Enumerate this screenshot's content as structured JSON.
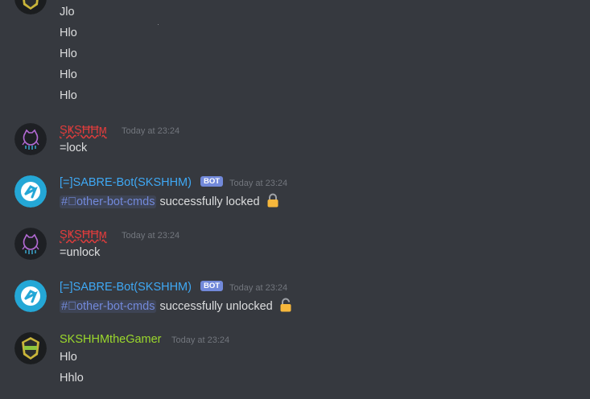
{
  "messages_top": [
    "Jlo",
    "Hlo",
    "Hlo",
    "Hlo",
    "Hlo"
  ],
  "group1": {
    "author": "ŞҜŞĦĦϻ",
    "timestamp": "Today at 23:24",
    "text": "=lock",
    "name_color": "#e03c3c"
  },
  "group2": {
    "author": "[=]SABRE-Bot(SKSHHM)",
    "bot_tag": "BOT",
    "timestamp": "Today at 23:24",
    "channel": "#⃣other-bot-cmds",
    "text": "successfully locked",
    "icon": "lock-closed-icon",
    "name_color": "#3fa9f5"
  },
  "group3": {
    "author": "ŞҜŞĦĦϻ",
    "timestamp": "Today at 23:24",
    "text": "=unlock",
    "name_color": "#e03c3c"
  },
  "group4": {
    "author": "[=]SABRE-Bot(SKSHHM)",
    "bot_tag": "BOT",
    "timestamp": "Today at 23:24",
    "channel": "#⃣other-bot-cmds",
    "text": "successfully unlocked",
    "icon": "lock-open-icon",
    "name_color": "#3fa9f5"
  },
  "group5": {
    "author": "SKSHHMtheGamer",
    "timestamp": "Today at 23:24",
    "lines": [
      "Hlo",
      "Hhlo"
    ],
    "name_color": "#9bd82c"
  }
}
